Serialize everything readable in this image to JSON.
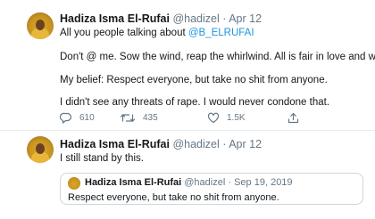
{
  "tweet1": {
    "author_name": "Hadiza Isma El-Rufai",
    "handle": "@hadizel",
    "separator": "·",
    "date": "Apr 12",
    "line1_prefix": "All you people talking about",
    "mention": "@B_ELRUFAI",
    "line2": "Don't @ me. Sow the wind, reap the whirlwind. All is fair in love and war.",
    "line3": "My belief: Respect everyone, but take no shit from anyone.",
    "line4": "I didn't see any threats of rape. I would never condone that.",
    "replies": "610",
    "retweets": "435",
    "likes": "1.5K"
  },
  "tweet2": {
    "author_name": "Hadiza Isma El-Rufai",
    "handle": "@hadizel",
    "separator": "·",
    "date": "Apr 12",
    "text": "I still stand by this.",
    "quote": {
      "author_name": "Hadiza Isma El-Rufai",
      "handle": "@hadizel",
      "separator": "·",
      "date": "Sep 19, 2019",
      "text": "Respect everyone, but take no shit from anyone."
    }
  },
  "icons": {
    "reply": "reply-icon",
    "retweet": "retweet-icon",
    "like": "heart-icon",
    "share": "share-icon"
  },
  "colors": {
    "link": "#1b95e0",
    "meta": "#657786",
    "text": "#14171a",
    "border": "#ccd6dd"
  }
}
